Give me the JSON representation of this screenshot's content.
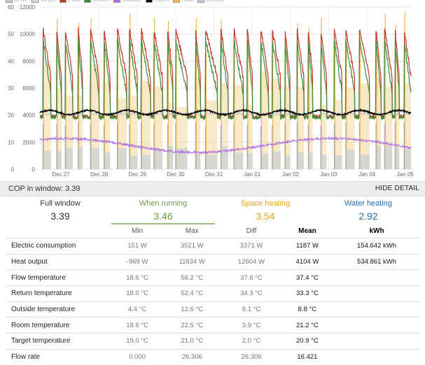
{
  "legend": [
    {
      "label": "DHW",
      "color": "#c8c8e0"
    },
    {
      "label": "Target",
      "color": "#d9d9d9"
    },
    {
      "label": "Flow",
      "color": "#c0392b"
    },
    {
      "label": "Return",
      "color": "#3a8f3a"
    },
    {
      "label": "Outside",
      "color": "#b070e0"
    },
    {
      "label": "Room",
      "color": "#000000"
    },
    {
      "label": "Heat",
      "color": "#f0b850"
    },
    {
      "label": "Electric",
      "color": "#b8c8d8"
    }
  ],
  "chart_data": {
    "type": "line",
    "left_axis": {
      "ticks": [
        "0",
        "10",
        "20",
        "30",
        "40",
        "50",
        "60"
      ],
      "ylim": [
        0,
        60
      ]
    },
    "right_axis": {
      "ticks": [
        "0",
        "2000",
        "4000",
        "6000",
        "8000",
        "10000",
        "12000"
      ],
      "ylim": [
        0,
        12000
      ]
    },
    "x_ticks": [
      "Dec 27",
      "Dec 28",
      "Dec 29",
      "Dec 30",
      "Dec 31",
      "Jan 01",
      "Jan 02",
      "Jan 03",
      "Jan 04",
      "Jan 05"
    ],
    "x_range_days": [
      0,
      9.7
    ],
    "grid": true,
    "series": [
      {
        "name": "Room",
        "axis": "left",
        "color": "#000000",
        "approx": "mean ~21.2, range 18.6–22.5"
      },
      {
        "name": "Outside",
        "axis": "left",
        "color": "#b070e0",
        "approx": "mean ~8.8, range 4.4–12.6"
      },
      {
        "name": "Flow",
        "axis": "left",
        "color": "#c0392b",
        "approx": "peaks ~45–56, decays to ~20"
      },
      {
        "name": "Return",
        "axis": "left",
        "color": "#3a8f3a",
        "approx": "peaks ~40–52, decays to ~19"
      },
      {
        "name": "Heat",
        "axis": "right",
        "color": "#f0b850",
        "approx": "spikes up to ~11600 W"
      },
      {
        "name": "Electric",
        "axis": "right",
        "color": "#b8c8d8",
        "approx": "mean ~1187 W"
      },
      {
        "name": "Target",
        "axis": "left",
        "color": "#d9d9d9",
        "approx": "~19–21"
      }
    ]
  },
  "cop": {
    "label": "COP in window: 3.39",
    "hide_detail": "HIDE DETAIL"
  },
  "summary": [
    {
      "title": "Full window",
      "value": "3.39",
      "color": "#333333",
      "active": false
    },
    {
      "title": "When running",
      "value": "3.46",
      "color": "#6a9a4a",
      "active": true
    },
    {
      "title": "Space heating",
      "value": "3.54",
      "color": "#e6a817",
      "active": false
    },
    {
      "title": "Water heating",
      "value": "2.92",
      "color": "#2a6ea8",
      "active": false
    }
  ],
  "table": {
    "headers": [
      "",
      "Min",
      "Max",
      "Diff",
      "Mean",
      "kWh"
    ],
    "rows": [
      {
        "name": "Electric consumption",
        "min": "151 W",
        "max": "3521 W",
        "diff": "3371 W",
        "mean": "1187 W",
        "kwh": "154.642 kWh"
      },
      {
        "name": "Heat output",
        "min": "-969 W",
        "max": "11634 W",
        "diff": "12604 W",
        "mean": "4104 W",
        "kwh": "534.861 kWh"
      },
      {
        "name": "Flow temperature",
        "min": "18.6 °C",
        "max": "56.2 °C",
        "diff": "37.6 °C",
        "mean": "37.4 °C",
        "kwh": ""
      },
      {
        "name": "Return temperature",
        "min": "18.0 °C",
        "max": "52.4 °C",
        "diff": "34.3 °C",
        "mean": "33.3 °C",
        "kwh": ""
      },
      {
        "name": "Outside temperature",
        "min": "4.4 °C",
        "max": "12.6 °C",
        "diff": "8.1 °C",
        "mean": "8.8 °C",
        "kwh": ""
      },
      {
        "name": "Room temperature",
        "min": "18.6 °C",
        "max": "22.5 °C",
        "diff": "3.9 °C",
        "mean": "21.2 °C",
        "kwh": ""
      },
      {
        "name": "Target temperature",
        "min": "19.0 °C",
        "max": "21.0 °C",
        "diff": "2.0 °C",
        "mean": "20.9 °C",
        "kwh": ""
      },
      {
        "name": "Flow rate",
        "min": "0.000",
        "max": "26.306",
        "diff": "26.306",
        "mean": "16.421",
        "kwh": ""
      }
    ]
  }
}
